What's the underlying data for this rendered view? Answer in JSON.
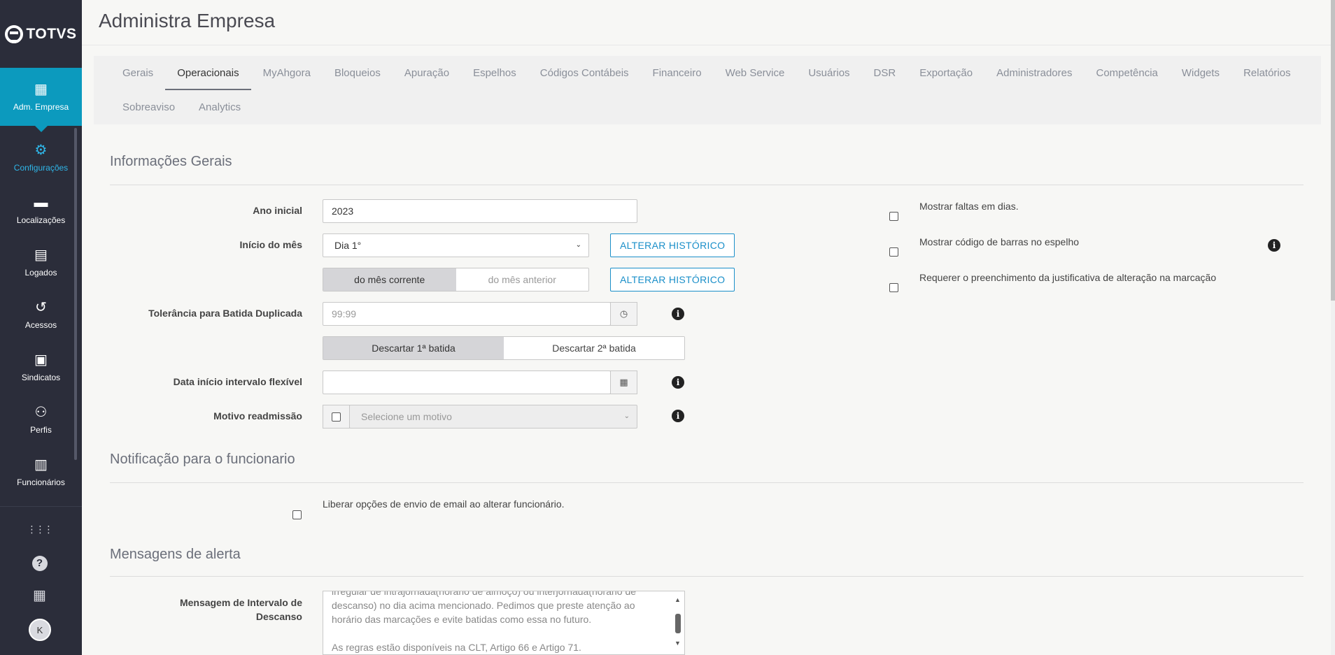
{
  "brand": {
    "name": "TOTVS"
  },
  "sidebar": {
    "items": [
      {
        "label": "Adm. Empresa",
        "icon": "company-settings-icon",
        "glyph": "▦"
      },
      {
        "label": "Configurações",
        "icon": "gear-icon",
        "glyph": "⚙"
      },
      {
        "label": "Localizações",
        "icon": "tag-icon",
        "glyph": "▬"
      },
      {
        "label": "Logados",
        "icon": "id-card-icon",
        "glyph": "▤"
      },
      {
        "label": "Acessos",
        "icon": "history-icon",
        "glyph": "↺"
      },
      {
        "label": "Sindicatos",
        "icon": "briefcase-icon",
        "glyph": "▣"
      },
      {
        "label": "Perfis",
        "icon": "users-icon",
        "glyph": "⚇"
      },
      {
        "label": "Funcionários",
        "icon": "clipboard-user-icon",
        "glyph": "▥"
      }
    ],
    "bottom": {
      "apps_glyph": "⋮⋮⋮",
      "help_glyph": "?",
      "building_glyph": "▦",
      "avatar_initial": "K"
    }
  },
  "header": {
    "title": "Administra Empresa"
  },
  "tabs": [
    "Gerais",
    "Operacionais",
    "MyAhgora",
    "Bloqueios",
    "Apuração",
    "Espelhos",
    "Códigos Contábeis",
    "Financeiro",
    "Web Service",
    "Usuários",
    "DSR",
    "Exportação",
    "Administradores",
    "Competência",
    "Widgets",
    "Relatórios",
    "Sobreaviso",
    "Analytics"
  ],
  "active_tab": "Operacionais",
  "sections": {
    "info": "Informações Gerais",
    "notif": "Notificação para o funcionario",
    "alerts": "Mensagens de alerta"
  },
  "form": {
    "ano_inicial": {
      "label": "Ano inicial",
      "value": "2023"
    },
    "inicio_mes": {
      "label": "Início do mês",
      "value": "Dia 1°",
      "btn": "ALTERAR HISTÓRICO",
      "seg_on": "do mês corrente",
      "seg_off": "do mês anterior",
      "btn2": "ALTERAR HISTÓRICO"
    },
    "tolerancia": {
      "label": "Tolerância para Batida Duplicada",
      "placeholder": "99:99",
      "seg_on": "Descartar 1ª batida",
      "seg_off": "Descartar 2ª batida"
    },
    "data_inicio": {
      "label": "Data início intervalo flexível",
      "value": ""
    },
    "motivo": {
      "label": "Motivo readmissão",
      "placeholder": "Selecione um motivo"
    },
    "checks": [
      "Mostrar faltas em dias.",
      "Mostrar código de barras no espelho",
      "Requerer o preenchimento da justificativa de alteração na marcação"
    ],
    "notif_check": "Liberar opções de envio de email ao alterar funcionário.",
    "mensagem": {
      "label_1": "Mensagem de Intervalo de",
      "label_2": "Descanso",
      "line_0": "irregular de intrajornada(horário de almoço) ou interjornada(horário de",
      "line_1": "descanso) no dia acima mencionado. Pedimos que preste atenção ao",
      "line_2": "horário das marcações e evite batidas como essa no futuro.",
      "line_4": "As regras estão disponíveis na CLT, Artigo 66 e Artigo 71."
    }
  },
  "colors": {
    "accent": "#0c9abe",
    "sidebar": "#2b2d3a",
    "link": "#1a8fc9"
  }
}
